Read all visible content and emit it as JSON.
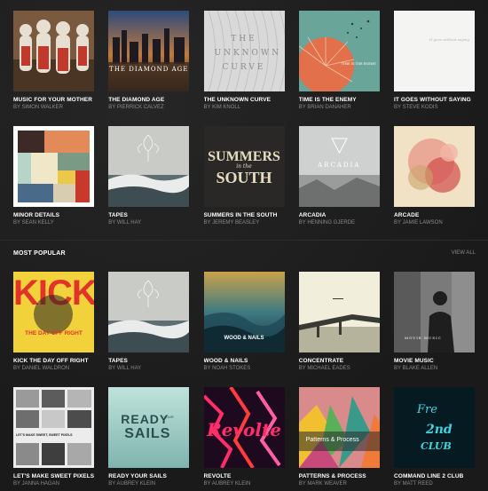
{
  "rows": [
    [
      {
        "title": "MUSIC FOR YOUR MOTHER",
        "author": "BY SIMON WALKER"
      },
      {
        "title": "THE DIAMOND AGE",
        "author": "BY PIERRICK CALVEZ",
        "cover_text": "THE DIAMOND AGE"
      },
      {
        "title": "THE UNKNOWN CURVE",
        "author": "BY KIM KNOLL",
        "cover_text": "THE UNKNOWN CURVE"
      },
      {
        "title": "TIME IS THE ENEMY",
        "author": "BY BRIAN DANAHER",
        "cover_text": "TIME IS THE ENEMY"
      },
      {
        "title": "IT GOES WITHOUT SAYING",
        "author": "BY STEVE KODIS",
        "cover_text": "It goes without saying"
      }
    ],
    [
      {
        "title": "MINOR DETAILS",
        "author": "BY SEAN KELLY"
      },
      {
        "title": "TAPES",
        "author": "BY WILL HAY"
      },
      {
        "title": "SUMMERS IN THE SOUTH",
        "author": "BY JEREMY BEASLEY",
        "cover_text_1": "SUMMERS",
        "cover_text_2": "in the",
        "cover_text_3": "SOUTH"
      },
      {
        "title": "ARCADIA",
        "author": "BY HENNING GJERDE",
        "cover_text": "ARCADIA"
      },
      {
        "title": "ARCADE",
        "author": "BY JAMIE LAWSON"
      }
    ],
    [
      {
        "title": "KICK THE DAY OFF RIGHT",
        "author": "BY DANIEL WALDRON",
        "cover_text_1": "KICK",
        "cover_text_2": "THE DAY OFF RIGHT"
      },
      {
        "title": "TAPES",
        "author": "BY WILL HAY"
      },
      {
        "title": "WOOD & NAILS",
        "author": "BY NOAH STOKES",
        "cover_text": "WOOD & NAILS"
      },
      {
        "title": "CONCENTRATE",
        "author": "BY MICHAEL EADES"
      },
      {
        "title": "MOVIE MUSIC",
        "author": "BY BLAKE ALLEN",
        "cover_text": "MOVIE MUSIC"
      }
    ],
    [
      {
        "title": "LET'S MAKE SWEET PIXELS",
        "author": "BY JANNA HAGAN",
        "cover_text": "LET'S MAKE SWEET, SWEET PIXELS"
      },
      {
        "title": "READY YOUR SAILS",
        "author": "BY AUBREY KLEIN",
        "cover_text_1": "READY",
        "cover_text_2": "YOUR",
        "cover_text_3": "SAILS"
      },
      {
        "title": "REVOLTE",
        "author": "BY AUBREY KLEIN",
        "cover_text": "Revolte"
      },
      {
        "title": "PATTERNS & PROCESS",
        "author": "BY MARK WEAVER",
        "cover_text": "Patterns & Process"
      },
      {
        "title": "COMMAND LINE 2 CLUB",
        "author": "BY MATT REED",
        "cover_text_1": "Fre",
        "cover_text_2": "2nd",
        "cover_text_3": "CLUB"
      }
    ]
  ],
  "section": {
    "label": "MOST POPULAR",
    "view_all": "VIEW ALL"
  }
}
